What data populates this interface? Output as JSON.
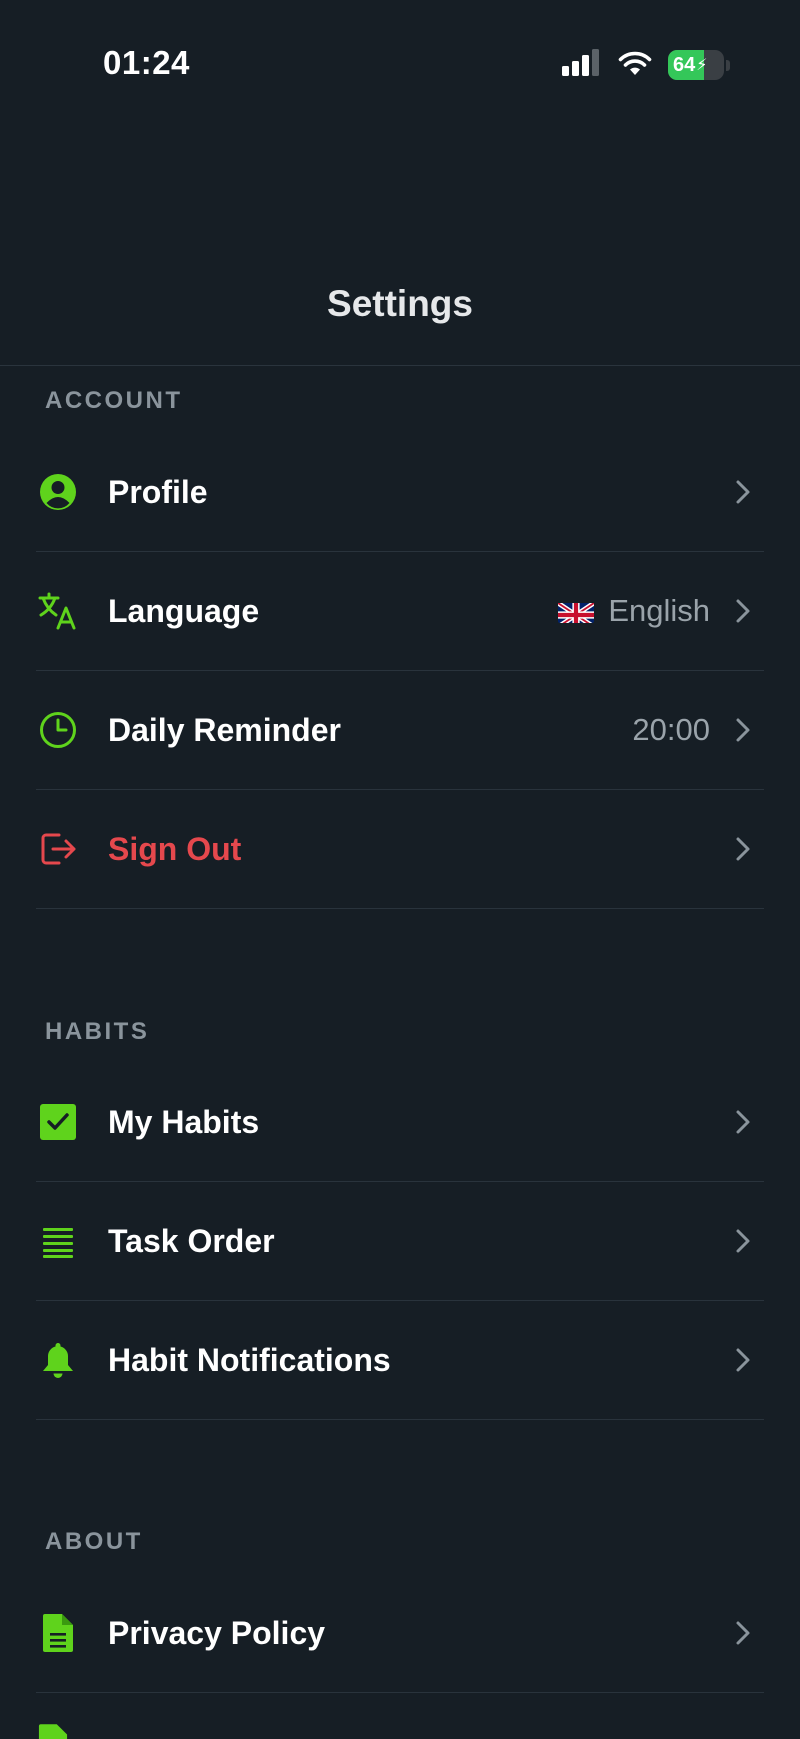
{
  "status_bar": {
    "time": "01:24",
    "battery_level": "64",
    "battery_fraction": 0.64
  },
  "header": {
    "title": "Settings"
  },
  "colors": {
    "background": "#161e25",
    "accent": "#5fd31c",
    "danger": "#e5484d",
    "divider": "#29333c",
    "secondary_text": "#9aa3aa"
  },
  "sections": {
    "account": {
      "title": "ACCOUNT",
      "items": [
        {
          "label": "Profile",
          "icon": "person-circle-icon"
        },
        {
          "label": "Language",
          "icon": "translate-icon",
          "value": "English",
          "value_icon": "uk-flag-icon"
        },
        {
          "label": "Daily Reminder",
          "icon": "clock-icon",
          "value": "20:00"
        },
        {
          "label": "Sign Out",
          "icon": "sign-out-icon"
        }
      ]
    },
    "habits": {
      "title": "HABITS",
      "items": [
        {
          "label": "My Habits",
          "icon": "checkbox-icon"
        },
        {
          "label": "Task Order",
          "icon": "list-lines-icon"
        },
        {
          "label": "Habit Notifications",
          "icon": "bell-icon"
        }
      ]
    },
    "about": {
      "title": "ABOUT",
      "items": [
        {
          "label": "Privacy Policy",
          "icon": "document-icon"
        }
      ]
    }
  }
}
